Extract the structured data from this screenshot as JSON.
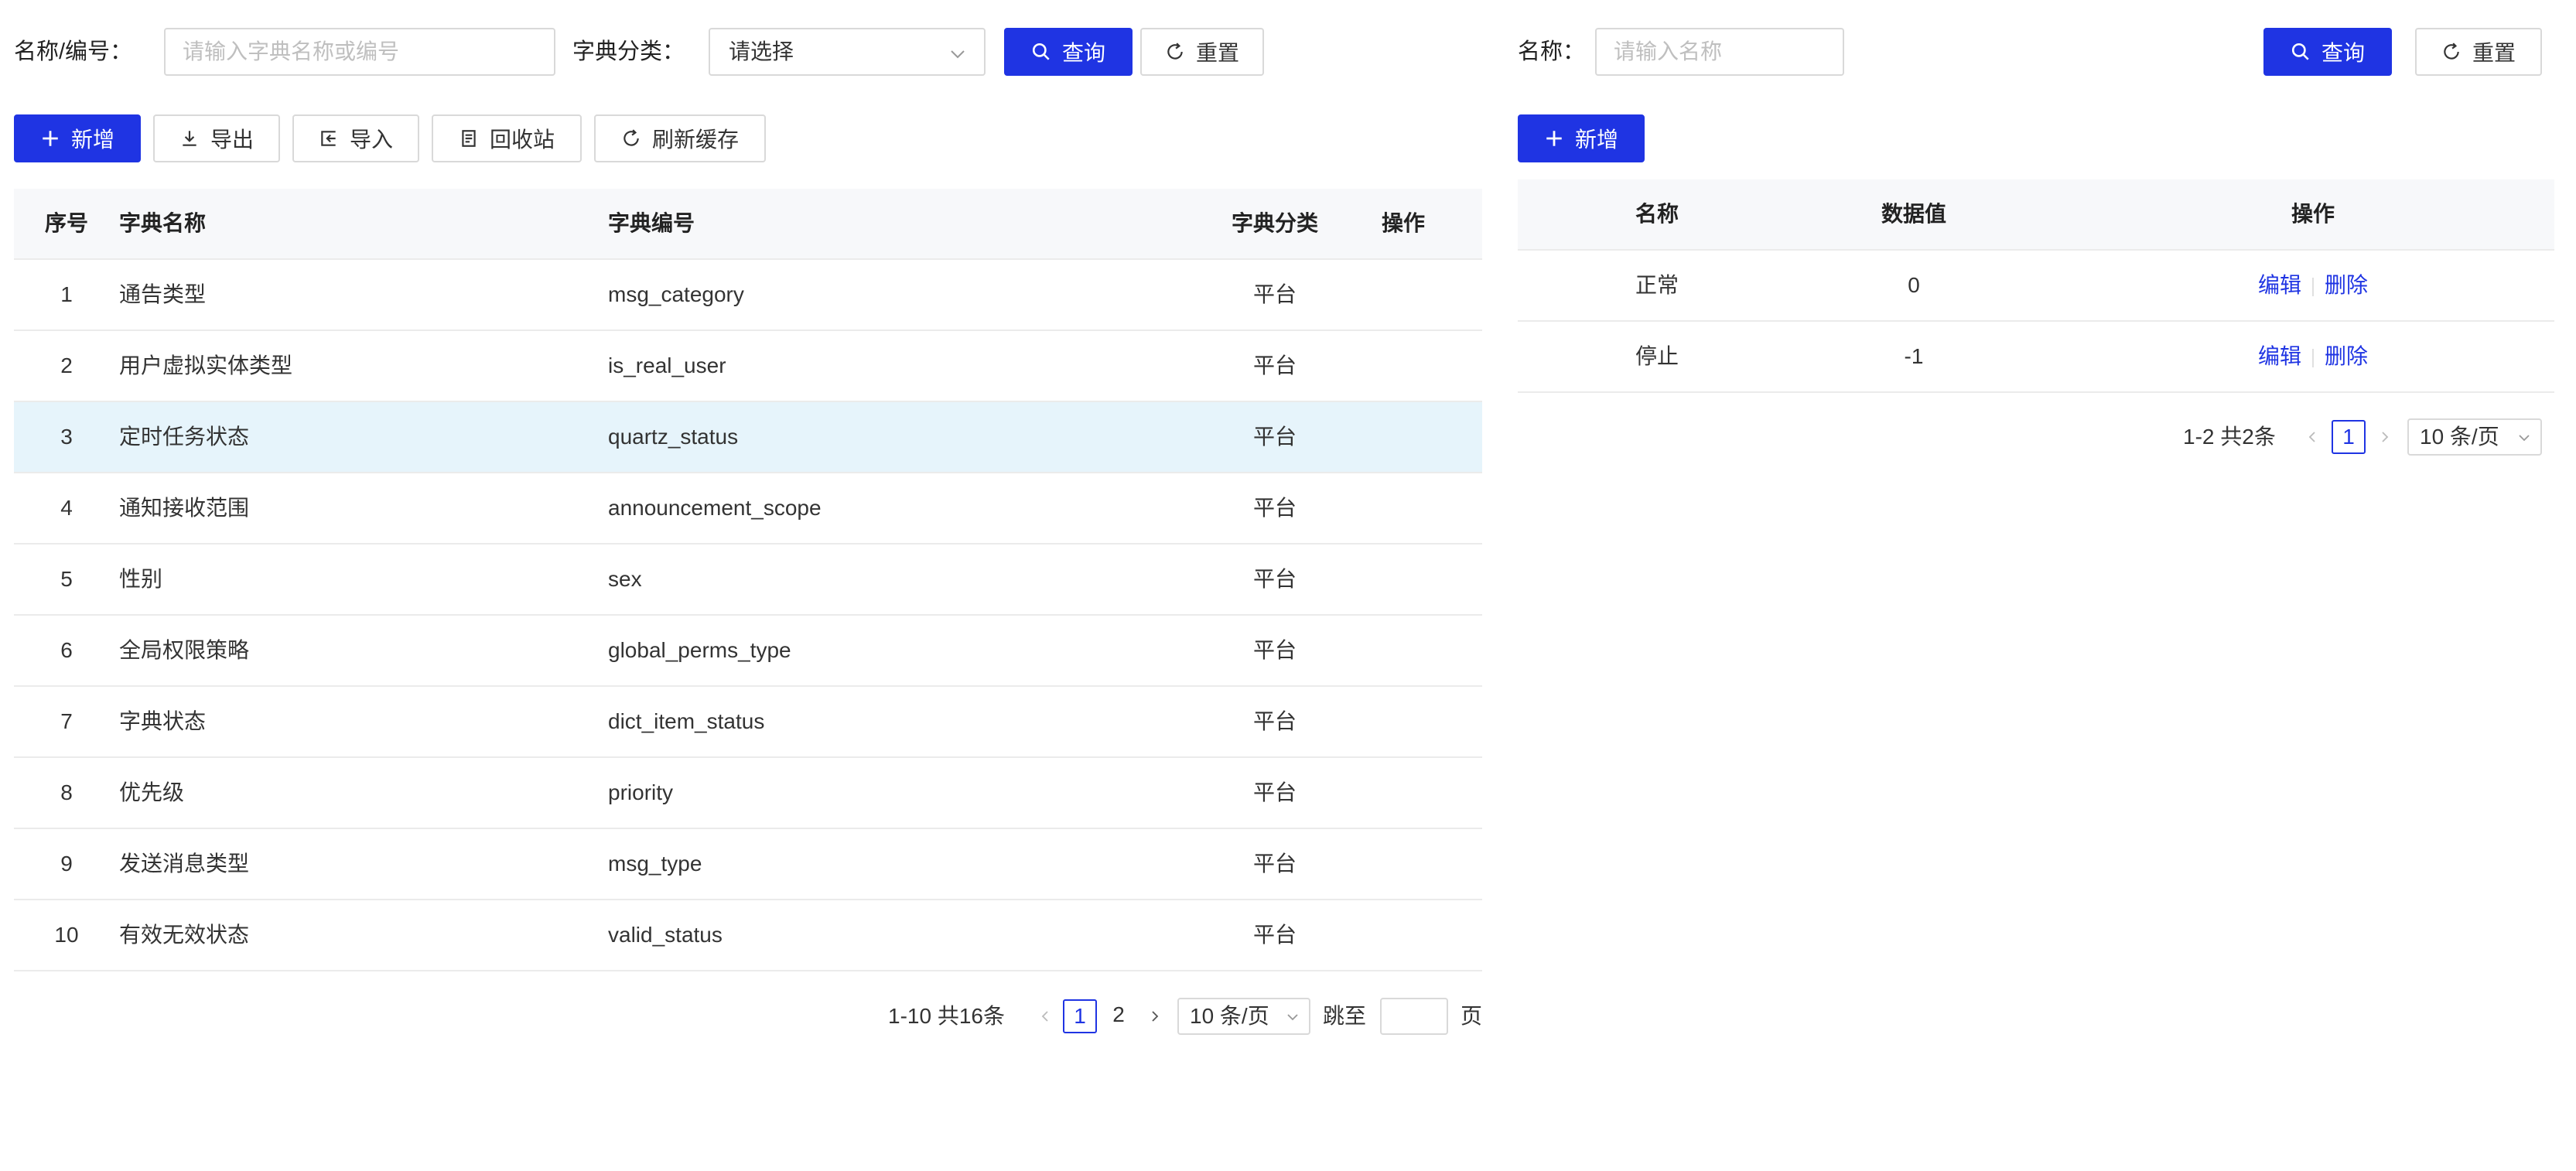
{
  "colors": {
    "primary": "#1f34e3",
    "selected_row": "#e6f4fb",
    "header_bg": "#f7f8fa"
  },
  "left": {
    "filters": {
      "name_label": "名称/编号：",
      "name_placeholder": "请输入字典名称或编号",
      "category_label": "字典分类：",
      "category_value": "请选择",
      "search_label": "查询",
      "reset_label": "重置"
    },
    "toolbar": {
      "add": "新增",
      "export": "导出",
      "import": "导入",
      "recycle": "回收站",
      "refresh": "刷新缓存"
    },
    "columns": [
      "序号",
      "字典名称",
      "字典编号",
      "字典分类",
      "操作"
    ],
    "rows": [
      {
        "no": "1",
        "name": "通告类型",
        "code": "msg_category",
        "category": "平台"
      },
      {
        "no": "2",
        "name": "用户虚拟实体类型",
        "code": "is_real_user",
        "category": "平台"
      },
      {
        "no": "3",
        "name": "定时任务状态",
        "code": "quartz_status",
        "category": "平台"
      },
      {
        "no": "4",
        "name": "通知接收范围",
        "code": "announcement_scope",
        "category": "平台"
      },
      {
        "no": "5",
        "name": "性别",
        "code": "sex",
        "category": "平台"
      },
      {
        "no": "6",
        "name": "全局权限策略",
        "code": "global_perms_type",
        "category": "平台"
      },
      {
        "no": "7",
        "name": "字典状态",
        "code": "dict_item_status",
        "category": "平台"
      },
      {
        "no": "8",
        "name": "优先级",
        "code": "priority",
        "category": "平台"
      },
      {
        "no": "9",
        "name": "发送消息类型",
        "code": "msg_type",
        "category": "平台"
      },
      {
        "no": "10",
        "name": "有效无效状态",
        "code": "valid_status",
        "category": "平台"
      }
    ],
    "selected_row": 3,
    "pagination": {
      "total": "1-10 共16条",
      "pages": [
        "1",
        "2"
      ],
      "current": "1",
      "page_size": "10 条/页",
      "jump_label": "跳至",
      "page_suffix": "页"
    }
  },
  "right": {
    "filters": {
      "name_label": "名称：",
      "name_placeholder": "请输入名称",
      "search_label": "查询",
      "reset_label": "重置"
    },
    "toolbar": {
      "add": "新增"
    },
    "columns": [
      "名称",
      "数据值",
      "操作"
    ],
    "rows": [
      {
        "name": "正常",
        "value": "0",
        "edit": "编辑",
        "delete": "删除"
      },
      {
        "name": "停止",
        "value": "-1",
        "edit": "编辑",
        "delete": "删除"
      }
    ],
    "pagination": {
      "total": "1-2 共2条",
      "current": "1",
      "page_size": "10 条/页"
    }
  }
}
